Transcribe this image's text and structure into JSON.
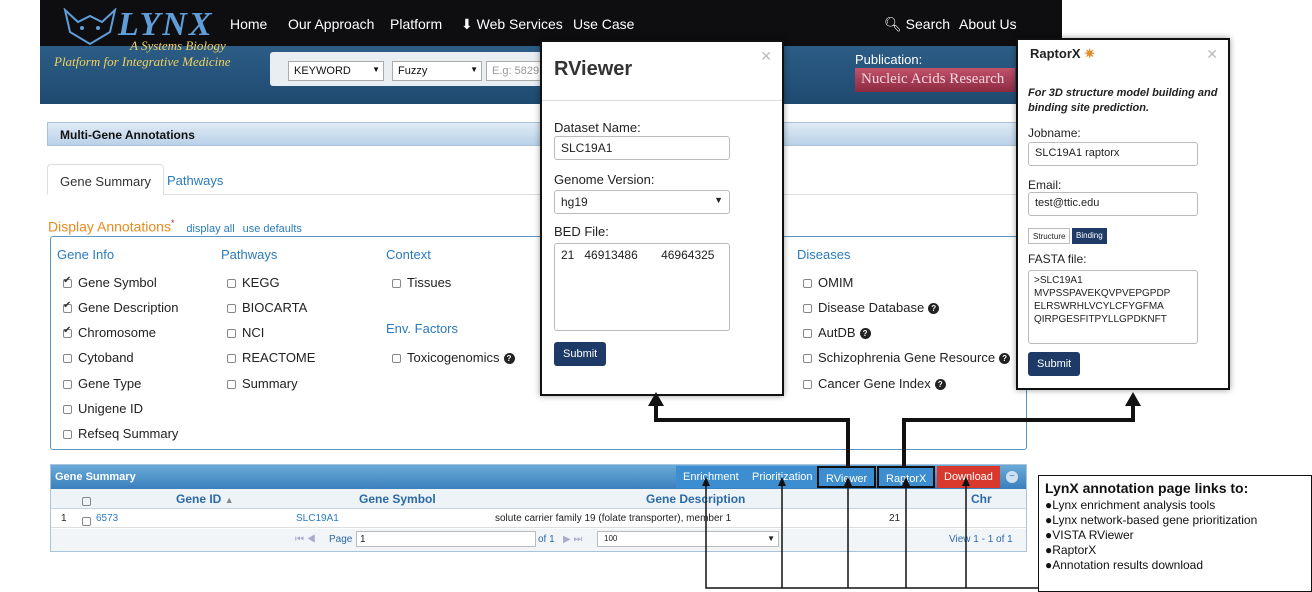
{
  "brand": {
    "name": "LYNX",
    "tagline1": "A Systems Biology",
    "tagline2": "Platform for Integrative Medicine"
  },
  "nav": {
    "home": "Home",
    "approach": "Our Approach",
    "platform": "Platform",
    "web_services": "Web Services",
    "use_case": "Use Case",
    "search": "Search",
    "about": "About Us"
  },
  "search": {
    "keyword": "KEYWORD",
    "mode": "Fuzzy",
    "placeholder": "E.g: 5829"
  },
  "publication": {
    "label": "Publication:",
    "journal": "Nucleic Acids Research"
  },
  "panel": {
    "title": "Multi-Gene Annotations"
  },
  "tabs": {
    "summary": "Gene Summary",
    "pathways": "Pathways"
  },
  "display": {
    "title": "Display Annotations",
    "asterisk": "*",
    "display_all": "display all",
    "use_defaults": "use defaults"
  },
  "columns": {
    "gene_info": "Gene Info",
    "pathways": "Pathways",
    "context": "Context",
    "env": "Env. Factors",
    "diseases": "Diseases"
  },
  "gene_info": [
    "Gene Symbol",
    "Gene Description",
    "Chromosome",
    "Cytoband",
    "Gene Type",
    "Unigene ID",
    "Refseq Summary"
  ],
  "pathway_items": [
    "KEGG",
    "BIOCARTA",
    "NCI",
    "REACTOME",
    "Summary"
  ],
  "context_items": [
    "Tissues"
  ],
  "env_items": [
    "Toxicogenomics"
  ],
  "disease_items": [
    "OMIM",
    "Disease Database",
    "AutDB",
    "Schizophrenia Gene Resource",
    "Cancer Gene Index"
  ],
  "grid": {
    "title": "Gene Summary",
    "buttons": {
      "enrichment": "Enrichment",
      "prioritization": "Prioritization",
      "rviewer": "RViewer",
      "raptorx": "RaptorX",
      "download": "Download"
    },
    "headers": {
      "gene_id": "Gene ID",
      "gene_symbol": "Gene Symbol",
      "gene_desc": "Gene Description",
      "chr": "Chr"
    },
    "row": {
      "index": "1",
      "gene_id": "6573",
      "gene_symbol": "SLC19A1",
      "gene_desc": "solute carrier family 19 (folate transporter), member 1",
      "chr": "21"
    },
    "pager": {
      "page_label": "Page",
      "page": "1",
      "of": "of 1",
      "rows": "100",
      "view": "View 1 - 1 of 1"
    }
  },
  "rviewer": {
    "logo": "RViewer",
    "dataset_label": "Dataset Name:",
    "dataset_value": "SLC19A1",
    "genome_label": "Genome Version:",
    "genome_value": "hg19",
    "bed_label": "BED File:",
    "bed_value": "21   46913486       46964325",
    "submit": "Submit"
  },
  "raptorx": {
    "logo": "RaptorX",
    "desc": "For 3D structure model building and binding site prediction.",
    "jobname_label": "Jobname:",
    "jobname_value": "SLC19A1 raptorx",
    "email_label": "Email:",
    "email_value": "test@ttic.edu",
    "toggle_structure": "Structure",
    "toggle_binding": "Binding",
    "fasta_label": "FASTA file:",
    "fasta_lines": [
      ">SLC19A1",
      "MVPSSPAVEKQVPVEPGPDP",
      "ELRSWRHLVCYLCFYGFMA",
      "QIRPGESFITPYLLGPDKNFT"
    ],
    "submit": "Submit"
  },
  "notes": {
    "title": "LynX annotation page links to:",
    "items": [
      "Lynx enrichment analysis tools",
      "Lynx network-based gene prioritization",
      "VISTA RViewer",
      "RaptorX",
      "Annotation results download"
    ]
  }
}
